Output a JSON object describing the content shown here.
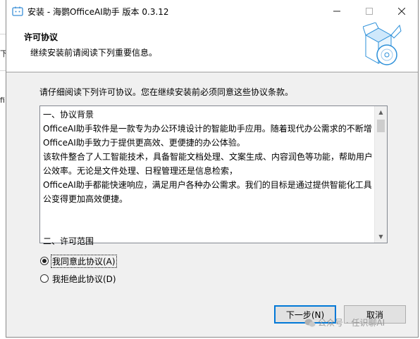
{
  "window": {
    "title": "安装 - 海鹦OfficeAI助手 版本 0.3.12",
    "minimize_icon": "minimize-icon",
    "maximize_icon": "maximize-icon",
    "close_icon": "close-icon"
  },
  "backdrop": {
    "snippet_1": "下",
    "snippet_2": "fi"
  },
  "header": {
    "title": "许可协议",
    "subtitle": "继续安装前请阅读下列重要信息。"
  },
  "intro": "请仔细阅读下列许可协议。您在继续安装前必须同意这些协议条款。",
  "license_lines": [
    "一、协议背景",
    "OfficeAI助手软件是一款专为办公环境设计的智能助手应用。随着现代办公需求的不断增长，",
    "OfficeAI助手致力于提供更高效、更便捷的办公体验。",
    "该软件整合了人工智能技术，具备智能文档处理、文案生成、内容润色等功能，帮助用户提升办",
    "公效率。无论是文件处理、日程管理还是信息检索，",
    "OfficeAI助手都能快速响应，满足用户各种办公需求。我们的目标是通过提供智能化工具，让办",
    "公变得更加高效便捷。",
    "",
    "",
    "二、许可范围"
  ],
  "radios": {
    "accept_label": "我同意此协议(A)",
    "decline_label": "我拒绝此协议(D)",
    "selected": "accept"
  },
  "buttons": {
    "next_label": "下一步(N)",
    "cancel_label": "取消"
  },
  "watermark": "公众号 · 任识聊AI",
  "colors": {
    "accent": "#0078d7",
    "dialog_bg": "#f0f0f0",
    "header_bg": "#ffffff"
  }
}
